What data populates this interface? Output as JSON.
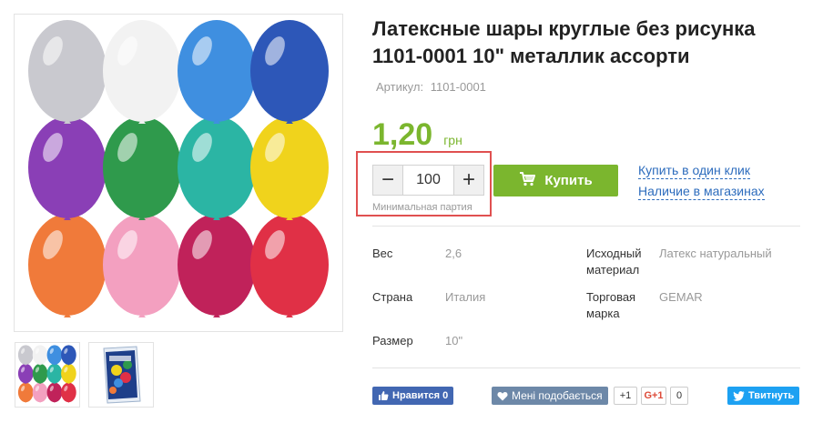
{
  "product": {
    "title": "Латексные шары круглые без рисунка 1101-0001 10\" металлик ассорти",
    "sku_label": "Артикул:",
    "sku_value": "1101-0001",
    "price_value": "1,20",
    "price_currency": "грн"
  },
  "purchase": {
    "quantity": "100",
    "minus_label": "−",
    "plus_label": "+",
    "min_hint": "Минимальная партия",
    "buy_label": "Купить",
    "one_click_label": "Купить в один клик",
    "availability_label": "Наличие в магазинах"
  },
  "specs": [
    {
      "label": "Вес",
      "value": "2,6"
    },
    {
      "label": "Исходный материал",
      "value": "Латекс натуральный"
    },
    {
      "label": "Страна",
      "value": "Италия"
    },
    {
      "label": "Торговая марка",
      "value": "GEMAR"
    },
    {
      "label": "Размер",
      "value": "10\""
    }
  ],
  "social": {
    "fb_like": "Нравится 0",
    "vk_like": "Мені подобається",
    "plus_one": "+1",
    "gplus": "G+1",
    "gplus_count": "0",
    "tweet": "Твитнуть"
  },
  "balloon_colors": [
    "#c9c9cf",
    "#f2f2f2",
    "#3f8fe0",
    "#2d57b8",
    "#8a3fb6",
    "#2f9a4c",
    "#2bb5a4",
    "#f0d31c",
    "#f07a3a",
    "#f3a0c0",
    "#c0225a",
    "#e03046"
  ],
  "icons": [
    "cart-icon",
    "thumb-up-icon",
    "vk-heart-icon",
    "twitter-bird-icon"
  ]
}
